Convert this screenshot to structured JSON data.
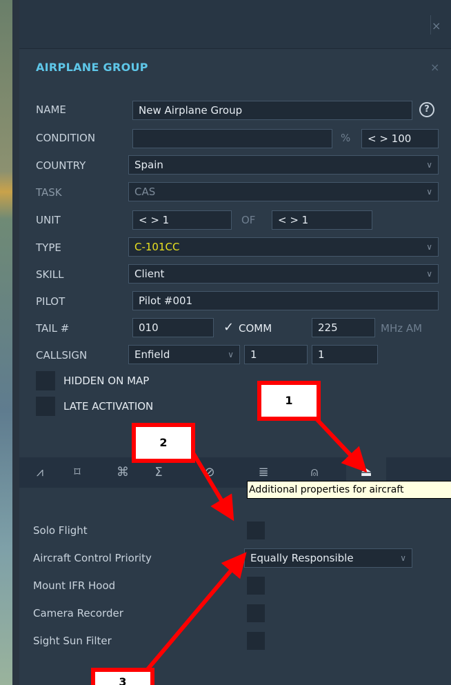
{
  "window": {
    "close_symbol": "×"
  },
  "dialog": {
    "title": "AIRPLANE GROUP",
    "close_symbol": "×"
  },
  "fields": {
    "name": {
      "label": "NAME",
      "value": "New Airplane Group",
      "help": "?"
    },
    "condition": {
      "label": "CONDITION",
      "value": "",
      "unit": "%",
      "spinner": "< >  100"
    },
    "country": {
      "label": "COUNTRY",
      "value": "Spain"
    },
    "task": {
      "label": "TASK",
      "value": "CAS"
    },
    "unit": {
      "label": "UNIT",
      "value": "< >  1",
      "of_label": "OF",
      "of_value": "< >  1"
    },
    "type": {
      "label": "TYPE",
      "value": "C-101CC"
    },
    "skill": {
      "label": "SKILL",
      "value": "Client"
    },
    "pilot": {
      "label": "PILOT",
      "value": "Pilot #001"
    },
    "tail": {
      "label": "TAIL #",
      "value": "010",
      "checked": true,
      "check_symbol": "✓",
      "comm_label": "COMM",
      "comm_value": "225",
      "comm_unit": "MHz AM"
    },
    "callsign": {
      "label": "CALLSIGN",
      "value": "Enfield",
      "num1": "1",
      "num2": "1"
    }
  },
  "checkboxes": {
    "hidden": "HIDDEN ON MAP",
    "late": "LATE ACTIVATION"
  },
  "tabs": [
    {
      "icon": "waypoints-icon",
      "glyph": "⩘"
    },
    {
      "icon": "target-icon",
      "glyph": "⌑"
    },
    {
      "icon": "command-icon",
      "glyph": "⌘"
    },
    {
      "icon": "sigma-icon",
      "glyph": "Σ"
    },
    {
      "icon": "prohibited-icon",
      "glyph": "⊘"
    },
    {
      "icon": "list-icon",
      "glyph": "≣"
    },
    {
      "icon": "radio-icon",
      "glyph": "⍝"
    },
    {
      "icon": "additional-properties-icon",
      "glyph": "⏏"
    }
  ],
  "tooltip": "Additional properties for aircraft",
  "properties": {
    "solo": "Solo Flight",
    "priority": {
      "label": "Aircraft Control Priority",
      "value": "Equally Responsible"
    },
    "ifr": "Mount IFR Hood",
    "camera": "Camera Recorder",
    "sun": "Sight Sun Filter"
  },
  "callouts": {
    "c1": "1",
    "c2": "2",
    "c3": "3"
  },
  "colors": {
    "accent": "#5ec6e8",
    "type_value": "#e8e020",
    "annotation": "#ff0000"
  }
}
